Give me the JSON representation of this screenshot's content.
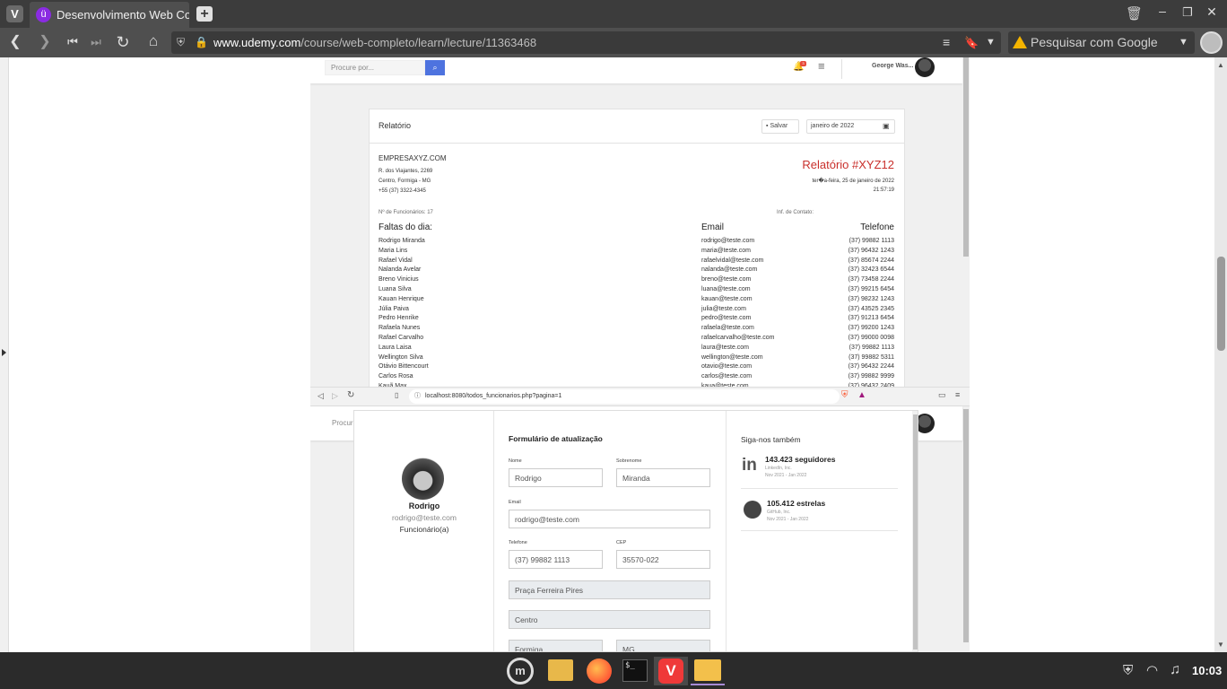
{
  "browser": {
    "tab_title": "Desenvolvimento Web Com",
    "new_tab_symbol": "+",
    "url_host": "www.udemy.com",
    "url_path": "/course/web-completo/learn/lecture/11363468",
    "search_placeholder": "Pesquisar com Google"
  },
  "upper_app": {
    "search_placeholder": "Procure por...",
    "notif_count": "3",
    "user_name": "George Was..."
  },
  "report": {
    "header_title": "Relatório",
    "save_label": "Salvar",
    "month_value": "janeiro de 2022",
    "company": "EMPRESAXYZ.COM",
    "address1": "R. dos Viajantes, 2269",
    "address2": "Centro, Formiga - MG",
    "phone": "+55 (37) 3322-4345",
    "report_title": "Relatório #XYZ12",
    "report_date": "ter�a-feira, 25 de janeiro de 2022",
    "report_time": "21:57:19",
    "employees_count": "Nº de Funcionários: 17",
    "contact_info": "Inf. de Contato:",
    "absences_heading": "Faltas do dia:",
    "email_heading": "Email",
    "phone_heading": "Telefone",
    "rows": [
      {
        "name": "Rodrigo Miranda",
        "email": "rodrigo@teste.com",
        "phone": "(37) 99882 1113"
      },
      {
        "name": "Maria Lins",
        "email": "maria@teste.com",
        "phone": "(37) 96432 1243"
      },
      {
        "name": "Rafael Vidal",
        "email": "rafaelvidal@teste.com",
        "phone": "(37) 85674 2244"
      },
      {
        "name": "Nalanda Avelar",
        "email": "nalanda@teste.com",
        "phone": "(37) 32423 6544"
      },
      {
        "name": "Breno Vinicius",
        "email": "breno@teste.com",
        "phone": "(37) 73458 2244"
      },
      {
        "name": "Luana Silva",
        "email": "luana@teste.com",
        "phone": "(37) 99215 6454"
      },
      {
        "name": "Kauan Henrique",
        "email": "kauan@teste.com",
        "phone": "(37) 98232 1243"
      },
      {
        "name": "Júlia Paiva",
        "email": "julia@teste.com",
        "phone": "(37) 43525 2345"
      },
      {
        "name": "Pedro Henrike",
        "email": "pedro@teste.com",
        "phone": "(37) 91213 6454"
      },
      {
        "name": "Rafaela Nunes",
        "email": "rafaela@teste.com",
        "phone": "(37) 99200 1243"
      },
      {
        "name": "Rafael Carvalho",
        "email": "rafaelcarvalho@teste.com",
        "phone": "(37) 99000 0098"
      },
      {
        "name": "Laura Laisa",
        "email": "laura@teste.com",
        "phone": "(37) 99882 1113"
      },
      {
        "name": "Wellington Silva",
        "email": "wellington@teste.com",
        "phone": "(37) 99882 5311"
      },
      {
        "name": "Otávio Bittencourt",
        "email": "otavio@teste.com",
        "phone": "(37) 96432 2244"
      },
      {
        "name": "Carlos Rosa",
        "email": "carlos@teste.com",
        "phone": "(37) 99882 9999"
      },
      {
        "name": "Kauã Max",
        "email": "kaua@teste.com",
        "phone": "(37) 96432 2409"
      }
    ]
  },
  "inner_browser": {
    "url": "localhost:8080/todos_funcionarios.php?pagina=1",
    "search_partial": "Procur"
  },
  "profile": {
    "name": "Rodrigo",
    "email": "rodrigo@teste.com",
    "role": "Funcionário(a)"
  },
  "form": {
    "title": "Formulário de atualização",
    "name_label": "Nome",
    "name_value": "Rodrigo",
    "surname_label": "Sobrenome",
    "surname_value": "Miranda",
    "email_label": "Email",
    "email_value": "rodrigo@teste.com",
    "phone_label": "Telefone",
    "phone_value": "(37) 99882 1113",
    "cep_label": "CEP",
    "cep_value": "35570-022",
    "street_value": "Praça Ferreira Pires",
    "district_value": "Centro",
    "city_value": "Formiga",
    "state_value": "MG"
  },
  "social": {
    "title": "Siga-nos também",
    "linkedin_count": "143.423 seguidores",
    "linkedin_source": "LinkedIn, Inc.",
    "linkedin_period": "Nov 2021 - Jan 2022",
    "github_count": "105.412 estrelas",
    "github_source": "GitHub, Inc.",
    "github_period": "Nov 2021 - Jan 2022"
  },
  "taskbar": {
    "clock": "10:03"
  },
  "colors": {
    "accent_red": "#c9302c",
    "vivaldi_red": "#ef3939",
    "chrome_dark": "#3c3c3c"
  }
}
